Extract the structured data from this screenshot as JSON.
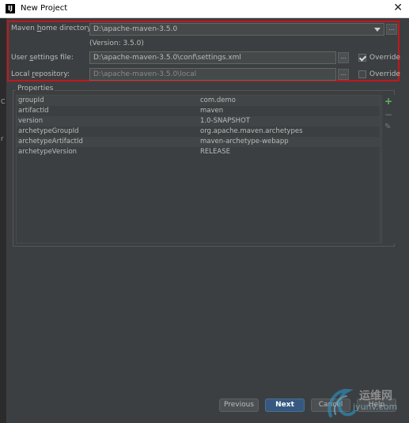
{
  "window": {
    "title": "New Project"
  },
  "left_strip": [
    "C",
    "r"
  ],
  "maven": {
    "home_label_pre": "Maven ",
    "home_label_u": "h",
    "home_label_post": "ome directory:",
    "home_value": "D:\\apache-maven-3.5.0",
    "version": "(Version: 3.5.0)",
    "settings_label_pre": "User ",
    "settings_label_u": "s",
    "settings_label_post": "ettings file:",
    "settings_value": "D:\\apache-maven-3.5.0\\conf\\settings.xml",
    "settings_override": "Override",
    "settings_override_checked": true,
    "repo_label_pre": "Local ",
    "repo_label_u": "r",
    "repo_label_post": "epository:",
    "repo_value": "D:\\apache-maven-3.5.0\\local",
    "repo_override": "Override",
    "repo_override_checked": false,
    "browse": "..."
  },
  "properties": {
    "title": "Properties",
    "rows": [
      {
        "key": "groupId",
        "value": "com.demo"
      },
      {
        "key": "artifactId",
        "value": "maven"
      },
      {
        "key": "version",
        "value": "1.0-SNAPSHOT"
      },
      {
        "key": "archetypeGroupId",
        "value": "org.apache.maven.archetypes"
      },
      {
        "key": "archetypeArtifactId",
        "value": "maven-archetype-webapp"
      },
      {
        "key": "archetypeVersion",
        "value": "RELEASE"
      }
    ],
    "tools": {
      "add": "+",
      "remove": "−",
      "edit": "✎"
    }
  },
  "buttons": {
    "previous": "Previous",
    "next": "Next",
    "cancel": "Cancel",
    "help": "Help"
  },
  "watermark": {
    "cn": "运维网",
    "url": "iyunv.com"
  },
  "colors": {
    "highlight_border": "#c4161c",
    "default_button": "#365880",
    "add_icon": "#5db85d"
  }
}
